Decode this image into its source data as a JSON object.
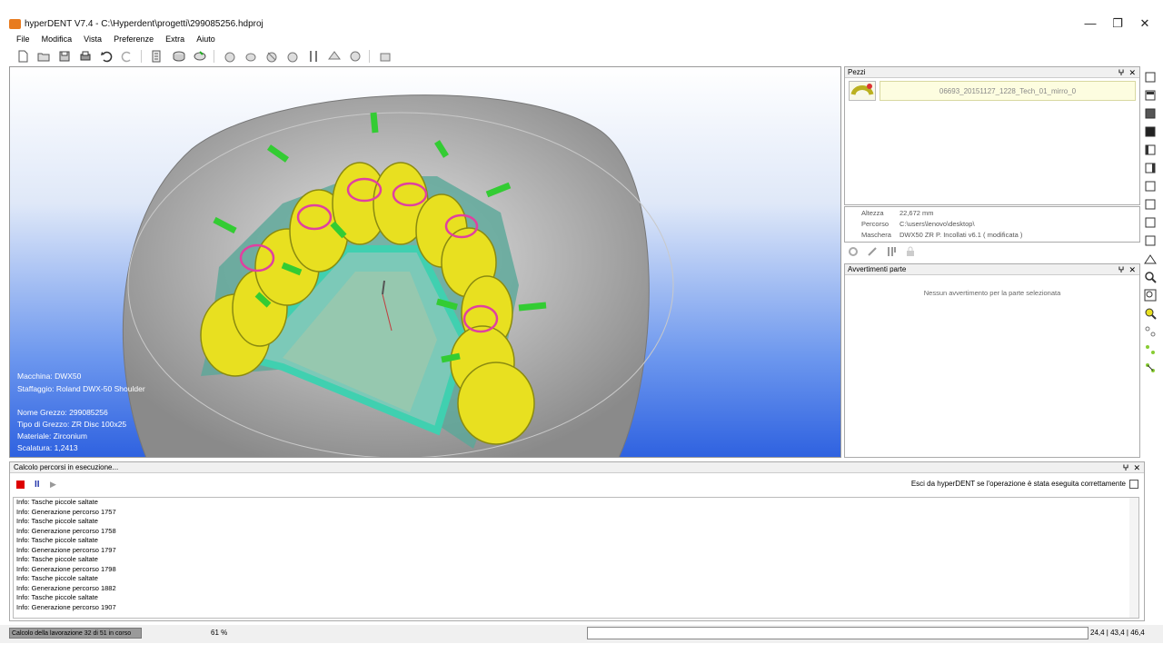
{
  "window": {
    "title": "hyperDENT V7.4 - C:\\Hyperdent\\progetti\\299085256.hdproj",
    "minimize": "—",
    "maximize": "❐",
    "close": "✕"
  },
  "menu": [
    "File",
    "Modifica",
    "Vista",
    "Preferenze",
    "Extra",
    "Aiuto"
  ],
  "viewport_info": {
    "machine": "Macchina: DWX50",
    "fixture": "Staffaggio: Roland DWX-50 Shoulder",
    "blank_name": "Nome Grezzo: 299085256",
    "blank_type": "Tipo di Grezzo: ZR Disc 100x25",
    "material": "Materiale: Zirconium",
    "scale": "Scalatura: 1,2413"
  },
  "pezzi": {
    "title": "Pezzi",
    "pin": "ⵖ",
    "close": "✕",
    "part_name": "06693_20151127_1228_Tech_01_mirro_0"
  },
  "properties": {
    "height_label": "Altezza",
    "height_value": "22,672 mm",
    "path_label": "Percorso",
    "path_value": "C:\\users\\lenovo\\desktop\\",
    "mask_label": "Maschera",
    "mask_value": "DWX50 ZR P. Incollati v6.1 ( modificata )"
  },
  "warnings": {
    "title": "Avvertimenti parte",
    "pin": "ⵖ",
    "close": "✕",
    "message": "Nessun avvertimento per la parte selezionata"
  },
  "calc": {
    "title": "Calcolo percorsi in esecuzione...",
    "pin": "ⵖ",
    "close": "✕",
    "pause": "II",
    "play": "▶",
    "exit_label": "Esci da hyperDENT se l'operazione è stata eseguita correttamente",
    "log": [
      "Info: Tasche piccole saltate",
      "Info: Generazione percorso 1757",
      "Info: Tasche piccole saltate",
      "Info: Generazione percorso 1758",
      "Info: Tasche piccole saltate",
      "Info: Generazione percorso 1797",
      "Info: Tasche piccole saltate",
      "Info: Generazione percorso 1798",
      "Info: Tasche piccole saltate",
      "Info: Generazione percorso 1882",
      "Info: Tasche piccole saltate",
      "Info: Generazione percorso 1907"
    ]
  },
  "status": {
    "progress_text": "Calcolo della lavorazione 32 di 51 in corso",
    "percent": "61 %",
    "coords": "24,4 | 43,4 | 46,4"
  },
  "colors": {
    "viewport_blue": "#2f62e0",
    "teeth_yellow": "#e8e020",
    "sprue_green": "#33cc33",
    "connector_teal": "#40d0b0"
  }
}
